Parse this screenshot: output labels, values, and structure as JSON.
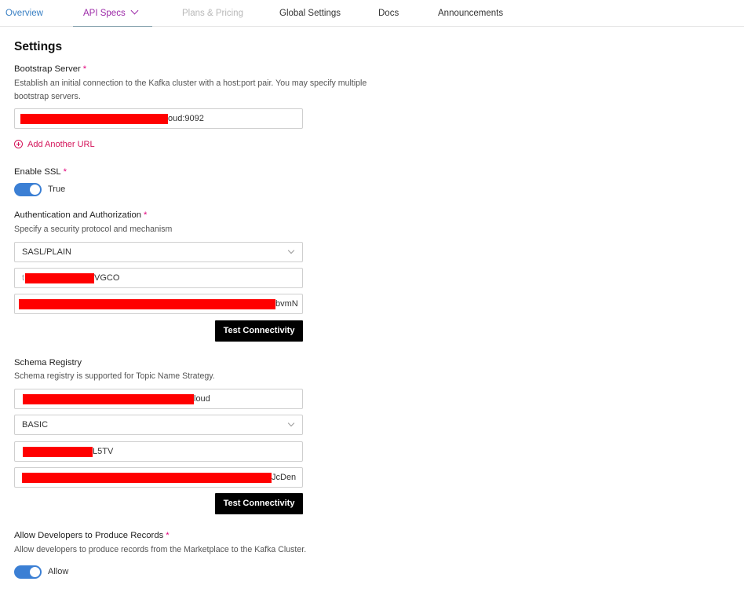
{
  "tabs": [
    {
      "label": "Overview"
    },
    {
      "label": "API Specs"
    },
    {
      "label": "Plans & Pricing"
    },
    {
      "label": "Global Settings"
    },
    {
      "label": "Docs"
    },
    {
      "label": "Announcements"
    }
  ],
  "settings": {
    "title": "Settings",
    "bootstrap": {
      "label": "Bootstrap Server",
      "required": "*",
      "help": "Establish an initial connection to the Kafka cluster with a host:port pair. You may specify multiple bootstrap servers.",
      "value_suffix": "oud:9092",
      "add_label": "Add Another URL"
    },
    "ssl": {
      "label": "Enable SSL",
      "required": "*",
      "toggle_label": "True",
      "on": true
    },
    "auth": {
      "label": "Authentication and Authorization",
      "required": "*",
      "help": "Specify a security protocol and mechanism",
      "protocol": "SASL/PLAIN",
      "username_suffix": "VGCO",
      "password_suffix": "bvmN",
      "test_button": "Test Connectivity"
    },
    "schema": {
      "label": "Schema Registry",
      "help": "Schema registry is supported for Topic Name Strategy.",
      "url_suffix": "loud",
      "auth_type": "BASIC",
      "key_suffix": "L5TV",
      "secret_suffix": "JcDen",
      "test_button": "Test Connectivity"
    },
    "produce": {
      "label": "Allow Developers to Produce Records",
      "required": "*",
      "help": "Allow developers to produce records from the Marketplace to the Kafka Cluster.",
      "toggle_label": "Allow",
      "on": true
    }
  },
  "colors": {
    "tab_link": "#3a80c4",
    "tab_active": "#9c2aa8",
    "required": "#e2007a",
    "add_link": "#d4145a",
    "toggle_on": "#3b7fd4",
    "redaction": "#ff0000",
    "button_bg": "#000000"
  }
}
